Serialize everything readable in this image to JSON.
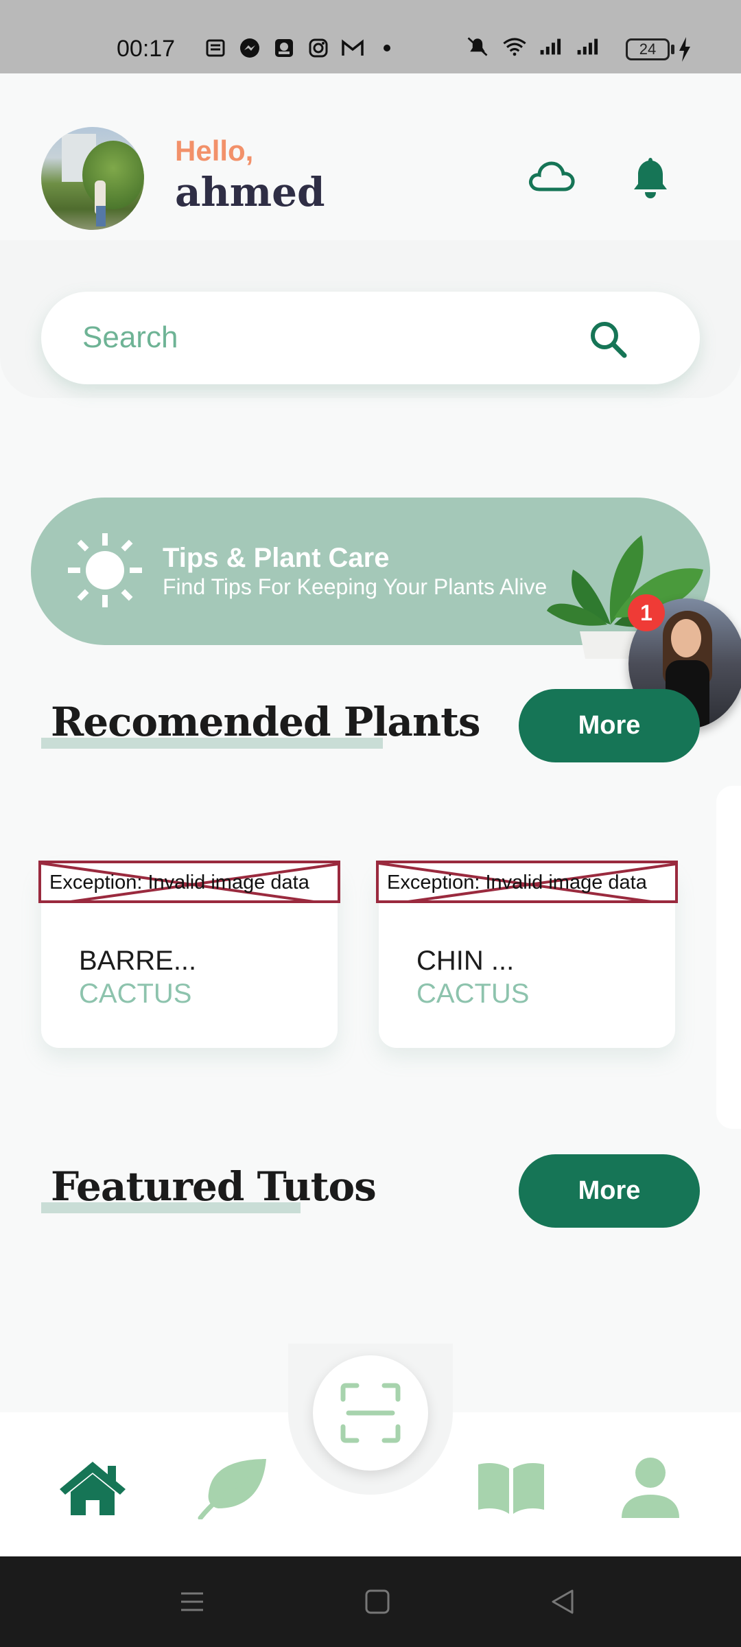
{
  "status_bar": {
    "time": "00:17",
    "battery": "24"
  },
  "header": {
    "greeting": "Hello,",
    "username": "ahmed"
  },
  "search": {
    "placeholder": "Search"
  },
  "tips": {
    "title": "Tips & Plant Care",
    "subtitle": "Find Tips For Keeping Your Plants Alive"
  },
  "chat_head": {
    "badge_count": "1"
  },
  "recommended": {
    "title": "Recomended Plants",
    "more_label": "More",
    "cards": [
      {
        "image_error": "Exception: Invalid image data",
        "name": "BARRE...",
        "category": "CACTUS"
      },
      {
        "image_error": "Exception: Invalid image data",
        "name": "CHIN ...",
        "category": "CACTUS"
      }
    ]
  },
  "featured": {
    "title": "Featured Tutos",
    "more_label": "More"
  },
  "bottom_nav": {
    "items": [
      {
        "icon": "home-icon",
        "active": true
      },
      {
        "icon": "leaf-icon",
        "active": false
      },
      {
        "icon": "scan-icon",
        "active": false
      },
      {
        "icon": "book-icon",
        "active": false
      },
      {
        "icon": "profile-icon",
        "active": false
      }
    ]
  },
  "colors": {
    "primary": "#167556",
    "accent_light": "#a4c8b8",
    "greeting": "#f2916a",
    "nav_inactive": "#a7d3ad"
  }
}
